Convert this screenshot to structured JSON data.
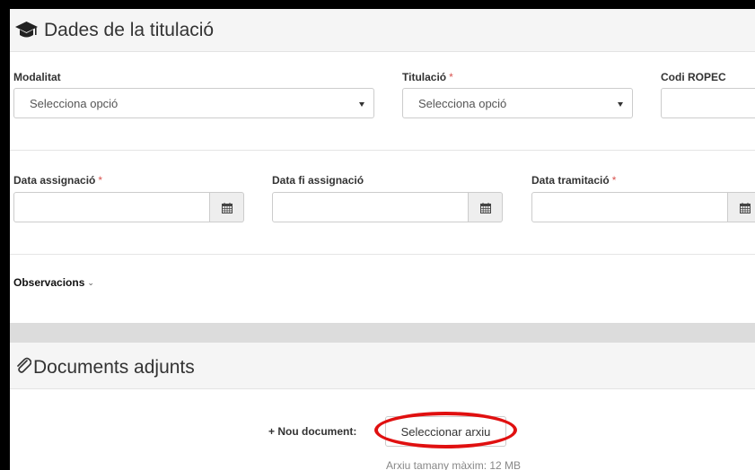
{
  "section_titulacio": {
    "title": "Dades de la titulació",
    "icon": "graduation-cap-icon",
    "modalitat": {
      "label": "Modalitat",
      "value": "Selecciona opció"
    },
    "titulacio": {
      "label": "Titulació",
      "required_mark": "*",
      "value": "Selecciona opció"
    },
    "codi_ropec": {
      "label": "Codi ROPEC",
      "value": ""
    },
    "data_assignacio": {
      "label": "Data assignació",
      "required_mark": "*",
      "value": "",
      "icon": "calendar-icon"
    },
    "data_fi_assignacio": {
      "label": "Data fi assignació",
      "value": "",
      "icon": "calendar-icon"
    },
    "data_tramitacio": {
      "label": "Data tramitació",
      "required_mark": "*",
      "value": "",
      "icon": "calendar-icon"
    },
    "observacions": {
      "label": "Observacions",
      "icon": "chevron-down-icon"
    }
  },
  "section_documents": {
    "title": "Documents adjunts",
    "icon": "paperclip-icon",
    "nou_document_label": "+ Nou document:",
    "select_file_button": "Seleccionar arxiu",
    "max_size_hint": "Arxiu tamany màxim: 12 MB"
  },
  "colors": {
    "required": "#d9534f",
    "highlight_circle": "#e01010",
    "panel_header_bg": "#f5f5f5"
  }
}
